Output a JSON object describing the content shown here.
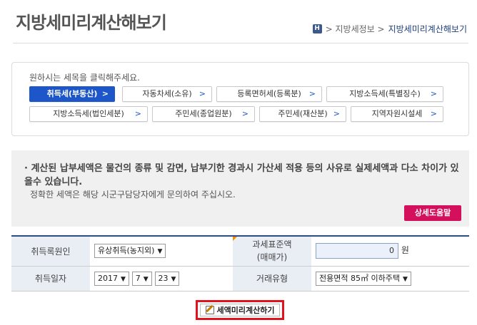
{
  "header": {
    "title": "지방세미리계산해보기",
    "breadcrumb_home": "H",
    "breadcrumb_1": "> 지방세정보 >",
    "breadcrumb_current": "지방세미리계산해보기"
  },
  "tax_select": {
    "guide": "원하시는 세목을 클릭해주세요.",
    "chevron": ">",
    "items": [
      {
        "label": "취득세(부동산)",
        "selected": true
      },
      {
        "label": "자동차세(소유)",
        "selected": false
      },
      {
        "label": "등록면허세(등록분)",
        "selected": false
      },
      {
        "label": "지방소득세(특별징수)",
        "selected": false
      },
      {
        "label": "지방소득세(법인세분)",
        "selected": false
      },
      {
        "label": "주민세(종업원분)",
        "selected": false
      },
      {
        "label": "주민세(재산분)",
        "selected": false
      },
      {
        "label": "지역자원시설세",
        "selected": false
      }
    ]
  },
  "notice": {
    "line1": "· 계산된 납부세액은 물건의 종류 및 감면, 납부기한 경과시 가산세 적용 등의 사유로 실제세액과 다소 차이가 있을수 있습니다.",
    "line2": "정확한 세액은 해당 시군구담당자에게 문의하여 주십시오.",
    "help_button": "상세도움말"
  },
  "form": {
    "acq_reason_label": "취득록원인",
    "acq_reason_value": "유상취득(농지외)",
    "tax_base_label_1": "과세표준액",
    "tax_base_label_2": "(매매가)",
    "tax_base_value": "0",
    "tax_base_unit": "원",
    "acq_date_label": "취득일자",
    "year": "2017",
    "month": "7",
    "day": "23",
    "trade_type_label": "거래유형",
    "trade_type_value": "전용면적 85㎡ 이하주택",
    "arrow": "▼"
  },
  "calc_button": "세액미리계산하기",
  "colors": {
    "accent": "#1d56c8",
    "help_button": "#d40f5c",
    "highlight_border": "#e0141e"
  }
}
